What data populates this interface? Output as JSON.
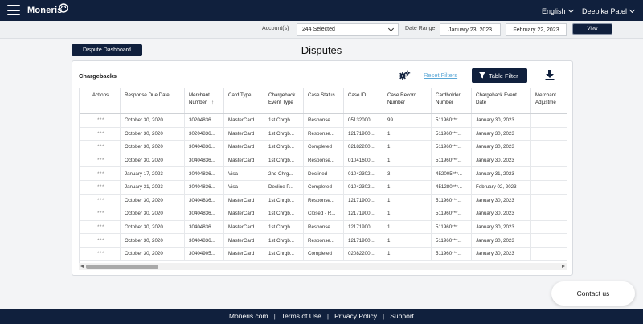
{
  "header": {
    "logo_text": "Moneris",
    "language": "English",
    "user_name": "Deepika Patel",
    "menu_icon": "hamburger-menu-icon",
    "brand_color": "#10203d"
  },
  "filters": {
    "account_label": "Account(s)",
    "account_value": "244 Selected",
    "date_range_label": "Date Range",
    "start_date": "January 23, 2023",
    "end_date": "February 22, 2023",
    "view_label": "View"
  },
  "page": {
    "dashboard_button": "Dispute Dashboard",
    "title": "Disputes"
  },
  "card": {
    "title": "Chargebacks",
    "reset_filters": "Reset Filters",
    "table_filter": "Table Filter",
    "settings_icon": "gears-icon",
    "download_icon": "download-icon",
    "link_color": "#5aa7d6"
  },
  "table": {
    "headers": [
      "Actions",
      "Response Due Date",
      "Merchant Number",
      "Card Type",
      "Chargeback Event Type",
      "Case Status",
      "Case ID",
      "Case Record Number",
      "Cardholder Number",
      "Chargeback Event Date",
      "Merchant Adjustme"
    ],
    "sort_indicator": "↑",
    "rows": [
      [
        "***",
        "October 30, 2020",
        "30204836...",
        "MasterCard",
        "1st Chrgb...",
        "Response...",
        "05132000...",
        "99",
        "511960***...",
        "January 30, 2023",
        ""
      ],
      [
        "***",
        "October 30, 2020",
        "30204836...",
        "MasterCard",
        "1st Chrgb...",
        "Response...",
        "12171900...",
        "1",
        "511960***...",
        "January 30, 2023",
        ""
      ],
      [
        "***",
        "October 30, 2020",
        "30404836...",
        "MasterCard",
        "1st Chrgb...",
        "Completed",
        "02182200...",
        "1",
        "511960***...",
        "January 30, 2023",
        ""
      ],
      [
        "***",
        "October 30, 2020",
        "30404836...",
        "MasterCard",
        "1st Chrgb...",
        "Response...",
        "01041600...",
        "1",
        "511960***...",
        "January 30, 2023",
        ""
      ],
      [
        "***",
        "January 17, 2023",
        "30404836...",
        "Visa",
        "2nd Chrg...",
        "Declined",
        "01042302...",
        "3",
        "452005***...",
        "January 31, 2023",
        ""
      ],
      [
        "***",
        "January 31, 2023",
        "30404836...",
        "Visa",
        "Decline P...",
        "Completed",
        "01042302...",
        "1",
        "451280***...",
        "February 02, 2023",
        ""
      ],
      [
        "***",
        "October 30, 2020",
        "30404836...",
        "MasterCard",
        "1st Chrgb...",
        "Response...",
        "12171900...",
        "1",
        "511960***...",
        "January 30, 2023",
        ""
      ],
      [
        "***",
        "October 30, 2020",
        "30404836...",
        "MasterCard",
        "1st Chrgb...",
        "Closed - R...",
        "12171900...",
        "1",
        "511960***...",
        "January 30, 2023",
        ""
      ],
      [
        "***",
        "October 30, 2020",
        "30404836...",
        "MasterCard",
        "1st Chrgb...",
        "Response...",
        "12171900...",
        "1",
        "511960***...",
        "January 30, 2023",
        ""
      ],
      [
        "***",
        "October 30, 2020",
        "30404836...",
        "MasterCard",
        "1st Chrgb...",
        "Response...",
        "12171900...",
        "1",
        "511960***...",
        "January 30, 2023",
        ""
      ],
      [
        "***",
        "October 30, 2020",
        "30404905...",
        "MasterCard",
        "1st Chrgb...",
        "Completed",
        "02082200...",
        "1",
        "511960***...",
        "January 30, 2023",
        ""
      ]
    ]
  },
  "contact": {
    "label": "Contact us"
  },
  "footer": {
    "links": [
      "Moneris.com",
      "Terms of Use",
      "Privacy Policy",
      "Support"
    ]
  }
}
